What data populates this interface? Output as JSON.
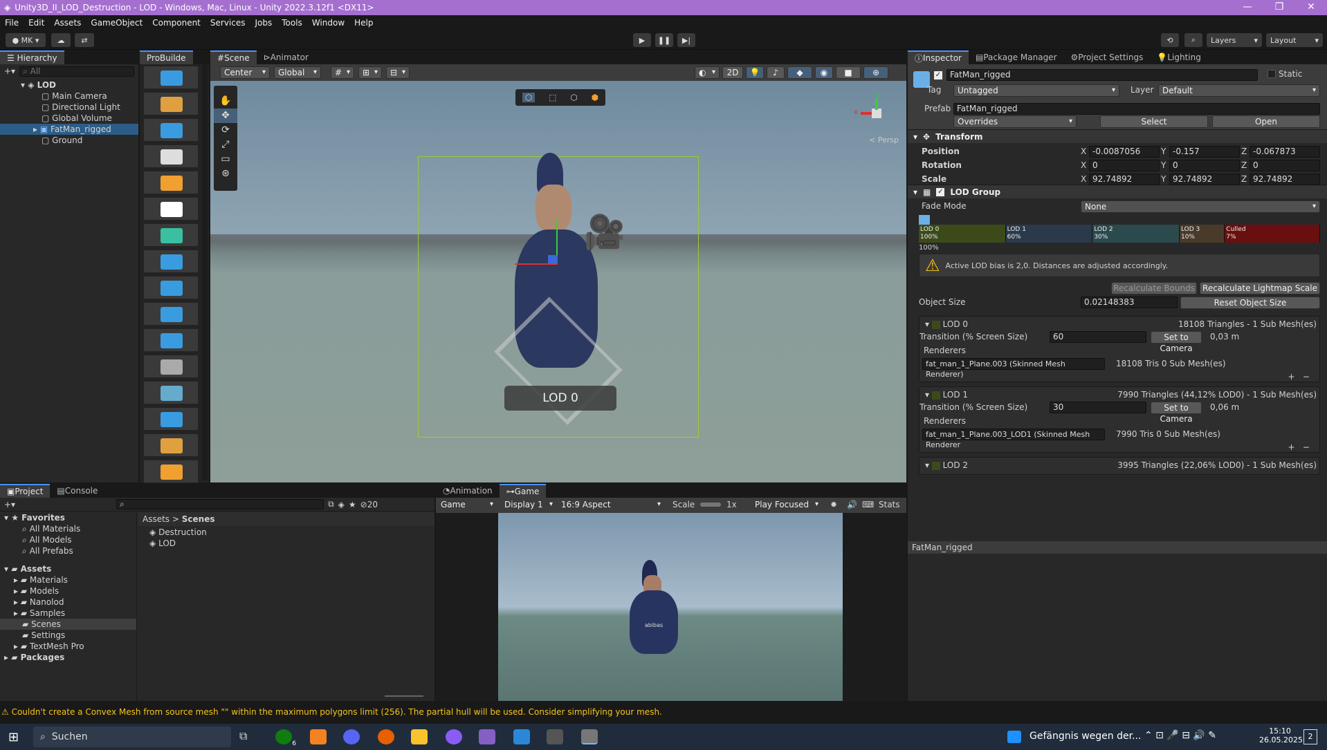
{
  "window": {
    "title": "Unity3D_II_LOD_Destruction - LOD - Windows, Mac, Linux - Unity 2022.3.12f1 <DX11>"
  },
  "menu": [
    "File",
    "Edit",
    "Assets",
    "GameObject",
    "Component",
    "Services",
    "Jobs",
    "Tools",
    "Window",
    "Help"
  ],
  "toolbar": {
    "account": "MK",
    "layers": "Layers",
    "layout": "Layout"
  },
  "hierarchy": {
    "tab": "Hierarchy",
    "search_placeholder": "All",
    "scene": "LOD",
    "items": [
      "Main Camera",
      "Directional Light",
      "Global Volume",
      "FatMan_rigged",
      "Ground"
    ]
  },
  "probuilder": {
    "tab": "ProBuilde"
  },
  "scene_view": {
    "tabs": [
      "Scene",
      "Animator"
    ],
    "pivot": "Center",
    "space": "Global",
    "twod": "2D",
    "persp": "< Persp",
    "lod_label": "LOD 0"
  },
  "inspector": {
    "tabs": [
      "Inspector",
      "Package Manager",
      "Project Settings",
      "Lighting"
    ],
    "object_name": "FatMan_rigged",
    "static": "Static",
    "tag_label": "Tag",
    "tag": "Untagged",
    "layer_label": "Layer",
    "layer": "Default",
    "prefab_label": "Prefab",
    "prefab": "FatMan_rigged",
    "overrides": "Overrides",
    "select": "Select",
    "open": "Open",
    "transform": {
      "title": "Transform",
      "position_label": "Position",
      "rotation_label": "Rotation",
      "scale_label": "Scale",
      "position": [
        "-0.0087056",
        "-0.157",
        "-0.067873"
      ],
      "rotation": [
        "0",
        "0",
        "0"
      ],
      "scale": [
        "92.74892",
        "92.74892",
        "92.74892"
      ]
    },
    "lodgroup": {
      "title": "LOD Group",
      "fade_label": "Fade Mode",
      "fade": "None",
      "bars": [
        {
          "name": "LOD 0",
          "pct": "100%",
          "color": "#3c4a1a"
        },
        {
          "name": "LOD 1",
          "pct": "60%",
          "color": "#2a3a4a"
        },
        {
          "name": "LOD 2",
          "pct": "30%",
          "color": "#2a4a4e"
        },
        {
          "name": "LOD 3",
          "pct": "10%",
          "color": "#4a3a2a"
        },
        {
          "name": "Culled",
          "pct": "7%",
          "color": "#6a0f0f"
        }
      ],
      "bar_start": "100%",
      "warning": "Active LOD bias is 2,0. Distances are adjusted accordingly.",
      "recalc_bounds": "Recalculate Bounds",
      "recalc_lightmap": "Recalculate Lightmap Scale",
      "object_size_label": "Object Size",
      "object_size": "0.02148383",
      "reset_size": "Reset Object Size",
      "lods": [
        {
          "name": "LOD 0",
          "info": "18108 Triangles - 1 Sub Mesh(es)",
          "transition": "60",
          "dist": "0,03 m",
          "renderer": "fat_man_1_Plane.003 (Skinned Mesh Renderer)",
          "tris": "18108 Tris  0 Sub Mesh(es)"
        },
        {
          "name": "LOD 1",
          "info": "7990 Triangles (44,12% LOD0) - 1 Sub Mesh(es)",
          "transition": "30",
          "dist": "0,06 m",
          "renderer": "fat_man_1_Plane.003_LOD1 (Skinned Mesh Renderer",
          "tris": "7990 Tris  0 Sub Mesh(es)"
        },
        {
          "name": "LOD 2",
          "info": "3995 Triangles (22,06% LOD0) - 1 Sub Mesh(es)"
        }
      ],
      "transition_label": "Transition (% Screen Size)",
      "set_to_camera": "Set to Camera",
      "renderers_label": "Renderers"
    },
    "footer_name": "FatMan_rigged"
  },
  "project": {
    "tabs": [
      "Project",
      "Console"
    ],
    "favorites": "Favorites",
    "fav_items": [
      "All Materials",
      "All Models",
      "All Prefabs"
    ],
    "assets": "Assets",
    "asset_items": [
      "Materials",
      "Models",
      "Nanolod",
      "Samples",
      "Scenes",
      "Settings",
      "TextMesh Pro"
    ],
    "packages": "Packages",
    "breadcrumb": [
      "Assets",
      "Scenes"
    ],
    "files": [
      "Destruction",
      "LOD"
    ],
    "hidden_count": "20"
  },
  "game_view": {
    "tabs": [
      "Animation",
      "Game"
    ],
    "mode": "Game",
    "display": "Display 1",
    "aspect": "16:9 Aspect",
    "scale_label": "Scale",
    "scale": "1x",
    "play": "Play Focused",
    "stats": "Stats",
    "shirt_text": "abibas"
  },
  "status": {
    "message": "Couldn't create a Convex Mesh from source mesh \"\" within the maximum polygons limit (256). The partial hull will be used. Consider simplifying your mesh."
  },
  "taskbar": {
    "search": "Suchen",
    "news": "Gefängnis wegen der...",
    "time": "15:10",
    "date": "26.05.2025",
    "notifications": "2",
    "xbox_badge": "6"
  }
}
